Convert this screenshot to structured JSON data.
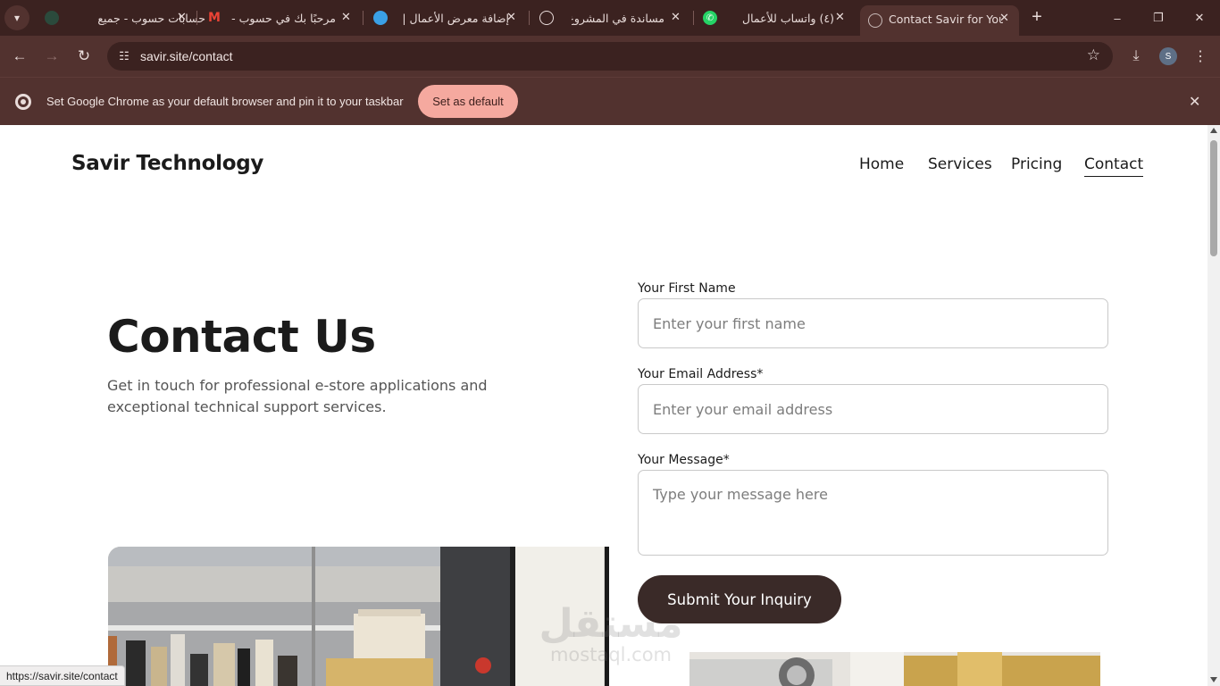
{
  "tabs": [
    {
      "title": "حسابات حسوب - جميع",
      "active": false
    },
    {
      "title": "مرحبًا بك في حسوب -",
      "active": false
    },
    {
      "title": "إضافة معرض الأعمال |",
      "active": false
    },
    {
      "title": "مساندة في المشروع",
      "active": false
    },
    {
      "title": "(٤) واتساب للأعمال",
      "active": false
    },
    {
      "title": "Contact Savir for Your",
      "active": true
    }
  ],
  "window_controls": {
    "minimize": "–",
    "restore": "❐",
    "close": "✕"
  },
  "toolbar": {
    "url": "savir.site/contact",
    "profile_initial": "S"
  },
  "infobar": {
    "message": "Set Google Chrome as your default browser and pin it to your taskbar",
    "button": "Set as default"
  },
  "site": {
    "brand": "Savir Technology",
    "nav": [
      {
        "label": "Home",
        "current": false
      },
      {
        "label": "Services",
        "current": false
      },
      {
        "label": "Pricing",
        "current": false
      },
      {
        "label": "Contact",
        "current": true
      }
    ]
  },
  "hero": {
    "title": "Contact Us",
    "subtitle": "Get in touch for professional e-store applications and exceptional technical support services."
  },
  "form": {
    "first_name_label": "Your First Name",
    "first_name_placeholder": "Enter your first name",
    "email_label": "Your Email Address*",
    "email_placeholder": "Enter your email address",
    "message_label": "Your Message*",
    "message_placeholder": "Type your message here",
    "submit": "Submit Your Inquiry"
  },
  "watermark": {
    "arabic": "مستقل",
    "latin": "mostaql.com"
  },
  "status_url": "https://savir.site/contact",
  "colors": {
    "frame_dark": "#3b2220",
    "frame": "#52322f",
    "accent_button": "#f5a99f",
    "submit_bg": "#3a2a28"
  }
}
